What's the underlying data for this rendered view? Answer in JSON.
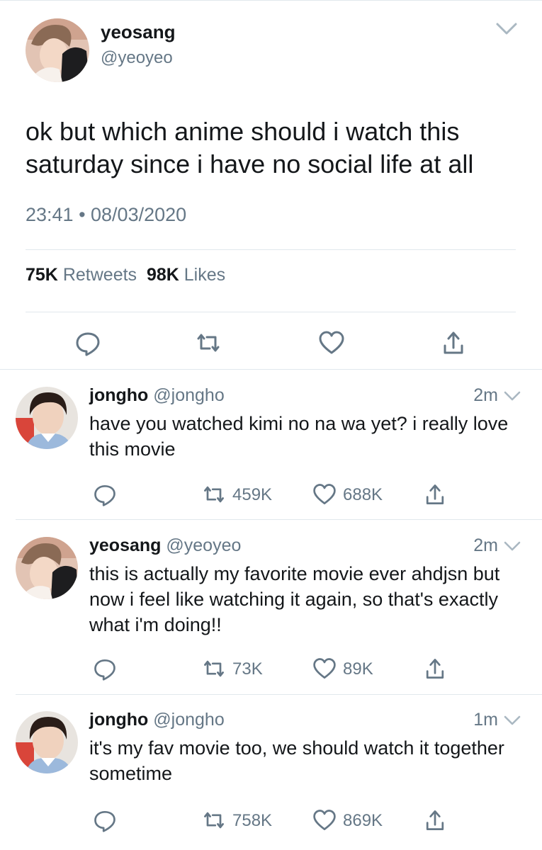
{
  "main_tweet": {
    "author_name": "yeosang",
    "author_handle": "@yeoyeo",
    "text": "ok but which anime should i watch this saturday since i have no social life at all",
    "timestamp": "23:41 • 08/03/2020",
    "retweets_count": "75K",
    "retweets_label": "Retweets",
    "likes_count": "98K",
    "likes_label": "Likes"
  },
  "replies": [
    {
      "name": "jongho",
      "handle": "@jongho",
      "time": "2m",
      "text": "have you watched kimi no na wa yet? i really love this movie",
      "retweets": "459K",
      "likes": "688K"
    },
    {
      "name": "yeosang",
      "handle": "@yeoyeo",
      "time": "2m",
      "text": "this is actually my favorite movie ever ahdjsn but now i feel like watching it again, so that's exactly what i'm doing!!",
      "retweets": "73K",
      "likes": "89K"
    },
    {
      "name": "jongho",
      "handle": "@jongho",
      "time": "1m",
      "text": "it's my fav movie too, we should watch it together sometime",
      "retweets": "758K",
      "likes": "869K"
    }
  ],
  "colors": {
    "text": "#14171a",
    "secondary": "#657786",
    "divider": "#e1e8ed"
  },
  "icons": [
    "chevron-down-icon",
    "reply-icon",
    "retweet-icon",
    "like-icon",
    "share-icon"
  ]
}
